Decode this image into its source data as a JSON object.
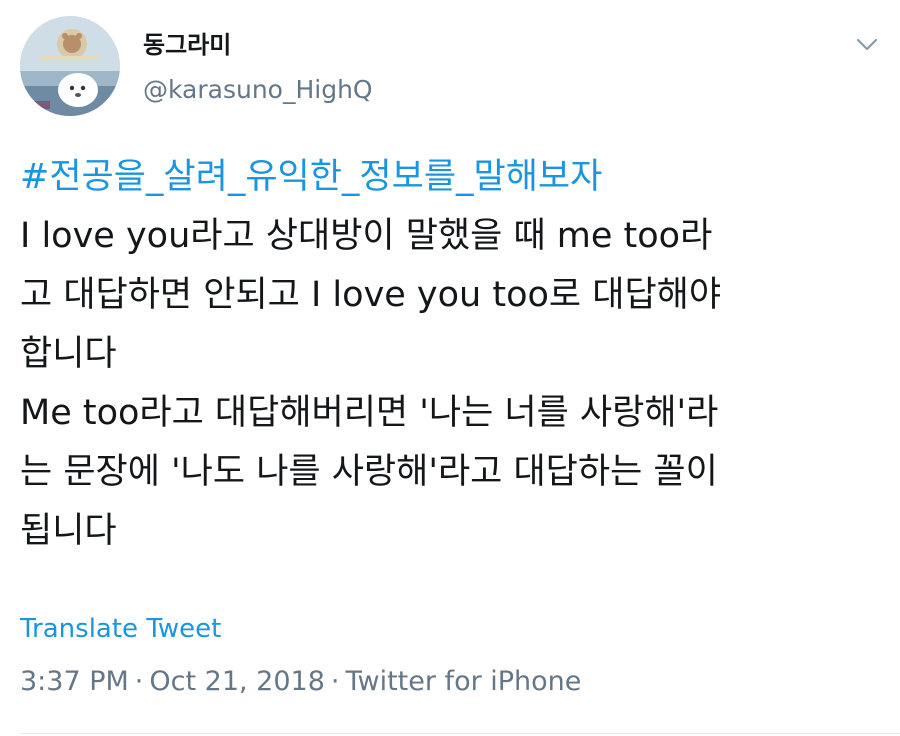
{
  "tweet": {
    "display_name": "동그라미",
    "handle": "@karasuno_HighQ",
    "hashtag": "#전공을_살려_유익한_정보를_말해보자",
    "body_lines": [
      "I love you라고 상대방이 말했을 때 me too라",
      "고 대답하면 안되고 I love you too로 대답해야",
      "합니다",
      "Me too라고 대답해버리면 '나는 너를 사랑해'라",
      "는 문장에 '나도 나를 사랑해'라고 대답하는 꼴이",
      "됩니다"
    ],
    "translate_label": "Translate Tweet",
    "time": "3:37 PM",
    "date": "Oct 21, 2018",
    "source": "Twitter for iPhone",
    "separator": "·"
  },
  "icons": {
    "more": "chevron-down-icon",
    "avatar": "avatar-image"
  },
  "colors": {
    "link": "#1b95e0",
    "secondary_text": "#657786",
    "primary_text": "#14171a"
  }
}
